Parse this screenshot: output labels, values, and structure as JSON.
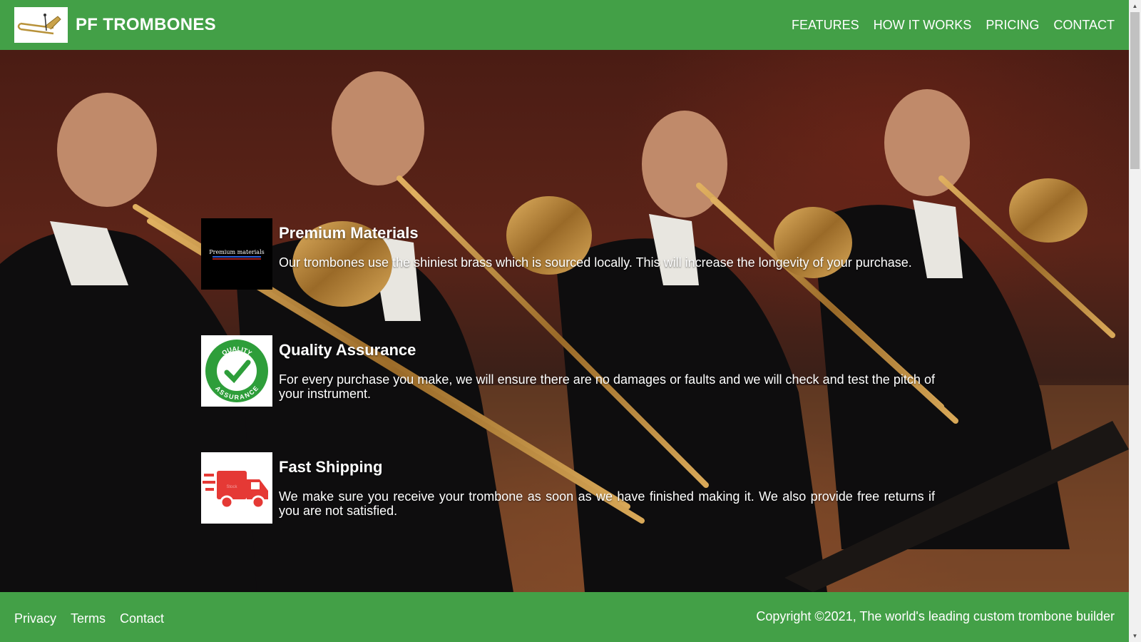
{
  "header": {
    "brand": "PF TROMBONES",
    "logo_icon": "trombone-logo-icon",
    "nav": [
      {
        "label": "FEATURES"
      },
      {
        "label": "HOW IT WORKS"
      },
      {
        "label": "PRICING"
      },
      {
        "label": "CONTACT"
      }
    ]
  },
  "features": [
    {
      "title": "Premium Materials",
      "description": "Our trombones use the shiniest brass which is sourced locally. This will increase the longevity of your purchase.",
      "image_text": "Premium materials"
    },
    {
      "title": "Quality Assurance",
      "description": "For every purchase you make, we will ensure there are no damages or faults and we will check and test the pitch of your instrument.",
      "image_text_top": "QUALITY",
      "image_text_bottom": "ASSURANCE"
    },
    {
      "title": "Fast Shipping",
      "description": "We make sure you receive your trombone as soon as we have finished making it. We also provide free returns if you are not satisfied.",
      "image_text": "Stock"
    }
  ],
  "footer": {
    "links": [
      {
        "label": "Privacy"
      },
      {
        "label": "Terms"
      },
      {
        "label": "Contact"
      }
    ],
    "copyright": "Copyright ©2021, The world's leading custom trombone builder"
  },
  "colors": {
    "primary_green": "#43a047",
    "text": "#ffffff"
  }
}
